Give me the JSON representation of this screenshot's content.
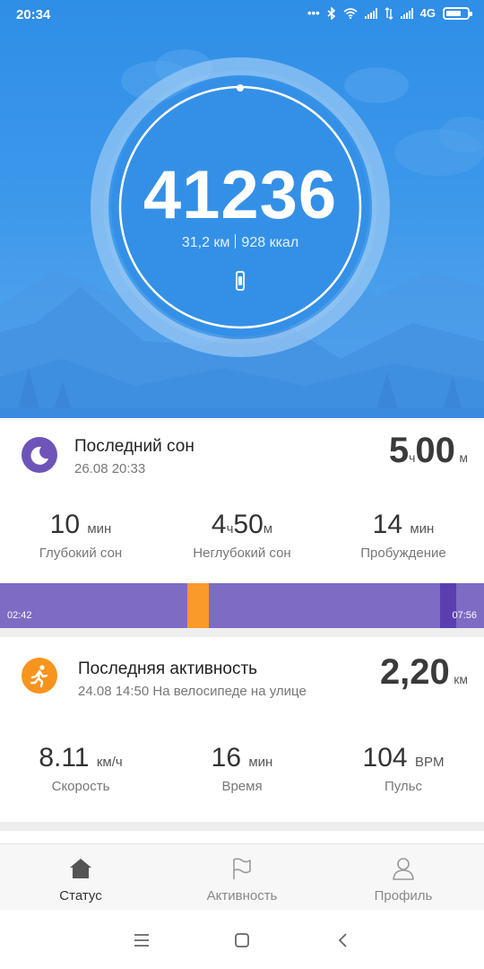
{
  "status_bar": {
    "time": "20:34",
    "network": "4G"
  },
  "hero": {
    "steps": "41236",
    "distance": "31,2 км",
    "calories": "928 ккал",
    "colors": {
      "background": "#3b97ea",
      "ring": "#ffffff"
    }
  },
  "sleep": {
    "title": "Последний сон",
    "datetime": "26.08 20:33",
    "total": {
      "hours": "5",
      "hours_unit": "ч",
      "minutes": "00",
      "minutes_unit": "м"
    },
    "stats": [
      {
        "value": "10",
        "unit": "мин",
        "label": "Глубокий сон"
      },
      {
        "hours": "4",
        "hours_unit": "ч",
        "minutes": "50",
        "minutes_unit": "м",
        "label": "Неглубокий сон"
      },
      {
        "value": "14",
        "unit": "мин",
        "label": "Пробуждение"
      }
    ],
    "timeline": {
      "start": "02:42",
      "end": "07:56"
    },
    "colors": {
      "light": "#7e6bc4",
      "awake": "#f99a2a",
      "deep": "#5a3fb0",
      "icon": "#6e54b8"
    }
  },
  "activity": {
    "title": "Последняя активность",
    "subtitle": "24.08 14:50 На велосипеде на улице",
    "distance": "2,20",
    "distance_unit": "км",
    "stats": [
      {
        "value": "8.11",
        "unit": "км/ч",
        "label": "Скорость"
      },
      {
        "value": "16",
        "unit": "мин",
        "label": "Время"
      },
      {
        "value": "104",
        "unit": "BPM",
        "label": "Пульс"
      }
    ],
    "colors": {
      "icon": "#f7941d"
    }
  },
  "nav": {
    "items": [
      {
        "label": "Статус",
        "icon": "home-icon",
        "active": true
      },
      {
        "label": "Активность",
        "icon": "flag-icon",
        "active": false
      },
      {
        "label": "Профиль",
        "icon": "profile-icon",
        "active": false
      }
    ]
  },
  "system_nav": [
    "menu-icon",
    "home-square-icon",
    "back-icon"
  ]
}
